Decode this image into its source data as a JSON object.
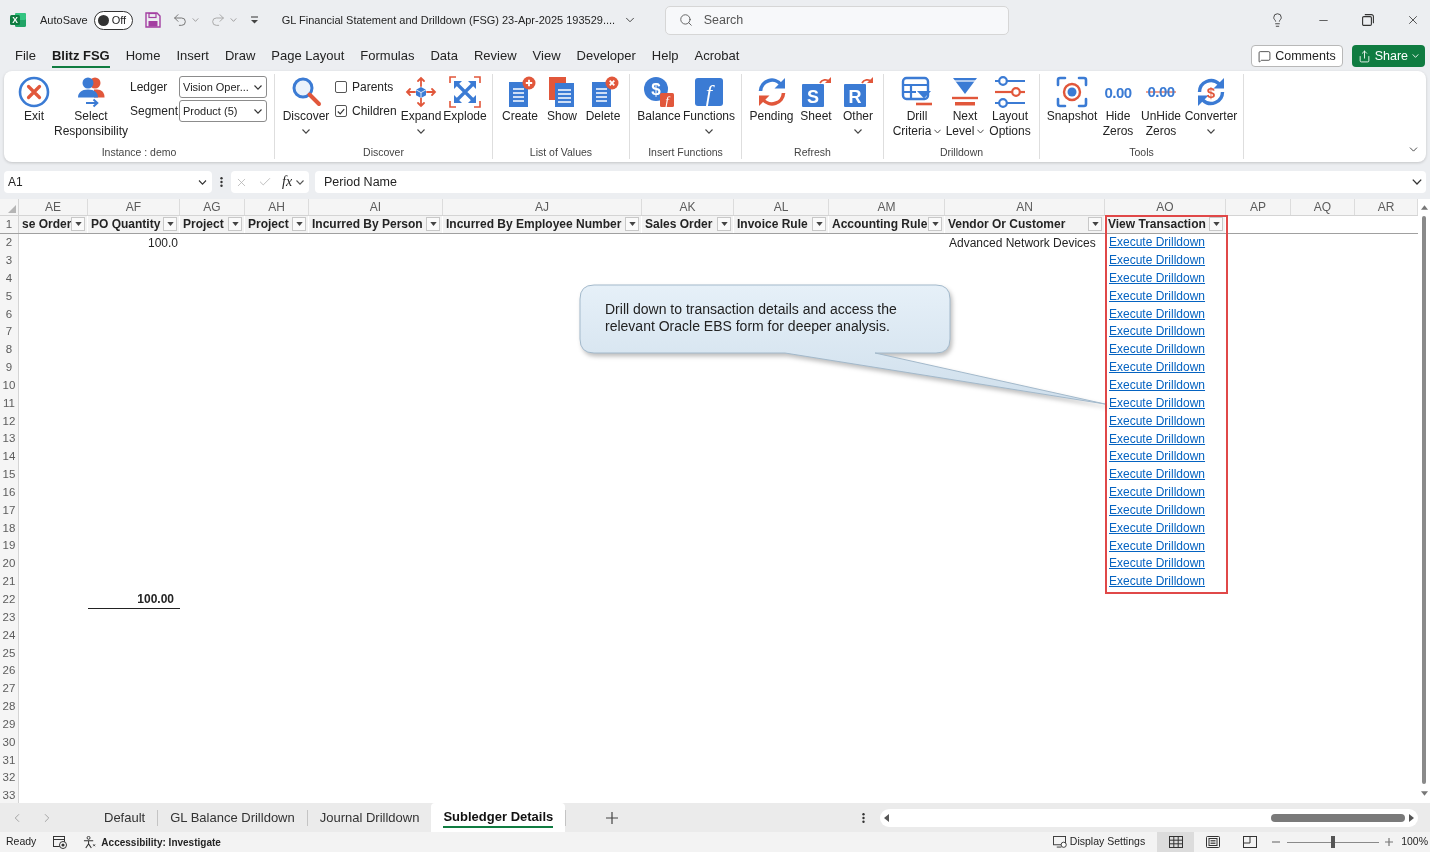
{
  "title_bar": {
    "app_logo_letter": "X",
    "autosave": {
      "label": "AutoSave",
      "toggle_text": "Off",
      "on": false
    },
    "document_title": "GL Financial Statement and Drilldown (FSG) 23-Apr-2025 193529....",
    "search": {
      "placeholder": "Search"
    }
  },
  "menu_tabs": [
    {
      "label": "File",
      "selected": false
    },
    {
      "label": "Blitz FSG",
      "selected": true
    },
    {
      "label": "Home",
      "selected": false
    },
    {
      "label": "Insert",
      "selected": false
    },
    {
      "label": "Draw",
      "selected": false
    },
    {
      "label": "Page Layout",
      "selected": false
    },
    {
      "label": "Formulas",
      "selected": false
    },
    {
      "label": "Data",
      "selected": false
    },
    {
      "label": "Review",
      "selected": false
    },
    {
      "label": "View",
      "selected": false
    },
    {
      "label": "Developer",
      "selected": false
    },
    {
      "label": "Help",
      "selected": false
    },
    {
      "label": "Acrobat",
      "selected": false
    }
  ],
  "header_buttons": [
    {
      "label": "Comments",
      "kind": "outline",
      "has_menu": false
    },
    {
      "label": "Share",
      "kind": "primary",
      "has_menu": true
    }
  ],
  "ribbon": {
    "groups": [
      {
        "label": "Instance : demo",
        "items": [
          {
            "kind": "large",
            "lines": [
              "Exit"
            ],
            "has_menu": false
          },
          {
            "kind": "large",
            "lines": [
              "Select",
              "Responsibility"
            ],
            "has_menu": false
          },
          {
            "kind": "fields",
            "fields": [
              {
                "label": "Ledger",
                "value": "Vision Oper..."
              },
              {
                "label": "Segment",
                "value": "Product (5)"
              }
            ]
          }
        ]
      },
      {
        "label": "Discover",
        "items": [
          {
            "kind": "large",
            "lines": [
              "Discover"
            ],
            "has_menu": true
          },
          {
            "kind": "checks",
            "options": [
              {
                "label": "Parents",
                "checked": false
              },
              {
                "label": "Children",
                "checked": true
              }
            ]
          },
          {
            "kind": "large",
            "lines": [
              "Expand"
            ],
            "has_menu": true
          },
          {
            "kind": "large",
            "lines": [
              "Explode"
            ],
            "has_menu": false
          }
        ]
      },
      {
        "label": "List of Values",
        "items": [
          {
            "kind": "large",
            "lines": [
              "Create"
            ],
            "has_menu": false
          },
          {
            "kind": "large",
            "lines": [
              "Show"
            ],
            "has_menu": false
          },
          {
            "kind": "large",
            "lines": [
              "Delete"
            ],
            "has_menu": false
          }
        ]
      },
      {
        "label": "Insert Functions",
        "items": [
          {
            "kind": "large",
            "lines": [
              "Balance"
            ],
            "has_menu": false,
            "icon_text": [
              "$",
              "f"
            ]
          },
          {
            "kind": "large",
            "lines": [
              "Functions"
            ],
            "has_menu": true,
            "icon_text": [
              "f"
            ]
          }
        ]
      },
      {
        "label": "Refresh",
        "items": [
          {
            "kind": "large",
            "lines": [
              "Pending"
            ],
            "has_menu": false
          },
          {
            "kind": "large",
            "lines": [
              "Sheet"
            ],
            "has_menu": false,
            "icon_text": [
              "S"
            ]
          },
          {
            "kind": "large",
            "lines": [
              "Other"
            ],
            "has_menu": true,
            "icon_text": [
              "R"
            ]
          }
        ]
      },
      {
        "label": "Drilldown",
        "items": [
          {
            "kind": "large",
            "lines": [
              "Drill",
              "Criteria"
            ],
            "has_menu": true
          },
          {
            "kind": "large",
            "lines": [
              "Next",
              "Level"
            ],
            "has_menu": true
          },
          {
            "kind": "large",
            "lines": [
              "Layout",
              "Options"
            ],
            "has_menu": false
          }
        ]
      },
      {
        "label": "Tools",
        "items": [
          {
            "kind": "large",
            "lines": [
              "Snapshot"
            ],
            "has_menu": false
          },
          {
            "kind": "large",
            "lines": [
              "Hide",
              "Zeros"
            ],
            "has_menu": false,
            "icon_text": [
              "0.00"
            ]
          },
          {
            "kind": "large",
            "lines": [
              "UnHide",
              "Zeros"
            ],
            "has_menu": false,
            "icon_text": [
              "0.00"
            ]
          },
          {
            "kind": "large",
            "lines": [
              "Converter"
            ],
            "has_menu": true,
            "icon_text": [
              "$"
            ]
          }
        ]
      }
    ]
  },
  "formula_bar": {
    "name_box": "A1",
    "function_label": "fx",
    "formula": "Period Name"
  },
  "sheet": {
    "column_letters": [
      "AE",
      "AF",
      "AG",
      "AH",
      "AI",
      "AJ",
      "AK",
      "AL",
      "AM",
      "AN",
      "AO",
      "AP",
      "AQ",
      "AR"
    ],
    "row_numbers": [
      "1",
      "2",
      "3",
      "4",
      "5",
      "6",
      "7",
      "8",
      "9",
      "10",
      "11",
      "12",
      "13",
      "14",
      "15",
      "16",
      "17",
      "18",
      "19",
      "20",
      "21",
      "22",
      "23",
      "24",
      "25",
      "26",
      "27",
      "28",
      "29",
      "30",
      "31",
      "32",
      "33"
    ],
    "header_cells": [
      {
        "text": "se Order",
        "filter": true
      },
      {
        "text": "PO Quantity",
        "filter": true
      },
      {
        "text": "Project",
        "filter": true
      },
      {
        "text": "Project",
        "filter": true
      },
      {
        "text": "Incurred By Person",
        "filter": true
      },
      {
        "text": "Incurred By Employee Number",
        "filter": true
      },
      {
        "text": "Sales Order",
        "filter": true
      },
      {
        "text": "Invoice Rule",
        "filter": true
      },
      {
        "text": "Accounting Rule",
        "filter": true
      },
      {
        "text": "Vendor Or Customer",
        "filter": true
      },
      {
        "text": "View Transaction",
        "filter": true
      }
    ],
    "rows": [
      {
        "kind": "data",
        "po_quantity": "100.0",
        "vendor_or_customer": "Advanced Network Devices",
        "view_transaction": "Execute Drilldown"
      },
      {
        "kind": "data",
        "view_transaction": "Execute Drilldown"
      },
      {
        "kind": "data",
        "view_transaction": "Execute Drilldown"
      },
      {
        "kind": "data",
        "view_transaction": "Execute Drilldown"
      },
      {
        "kind": "data",
        "view_transaction": "Execute Drilldown"
      },
      {
        "kind": "data",
        "view_transaction": "Execute Drilldown"
      },
      {
        "kind": "data",
        "view_transaction": "Execute Drilldown"
      },
      {
        "kind": "data",
        "view_transaction": "Execute Drilldown"
      },
      {
        "kind": "data",
        "view_transaction": "Execute Drilldown"
      },
      {
        "kind": "data",
        "view_transaction": "Execute Drilldown"
      },
      {
        "kind": "data",
        "view_transaction": "Execute Drilldown"
      },
      {
        "kind": "data",
        "view_transaction": "Execute Drilldown"
      },
      {
        "kind": "data",
        "view_transaction": "Execute Drilldown"
      },
      {
        "kind": "data",
        "view_transaction": "Execute Drilldown"
      },
      {
        "kind": "data",
        "view_transaction": "Execute Drilldown"
      },
      {
        "kind": "data",
        "view_transaction": "Execute Drilldown"
      },
      {
        "kind": "data",
        "view_transaction": "Execute Drilldown"
      },
      {
        "kind": "data",
        "view_transaction": "Execute Drilldown"
      },
      {
        "kind": "data",
        "view_transaction": "Execute Drilldown"
      },
      {
        "kind": "data",
        "view_transaction": "Execute Drilldown"
      },
      {
        "kind": "total",
        "po_quantity": "100.00"
      }
    ],
    "callout": {
      "text": "Drill down to transaction details and access the relevant Oracle EBS form for deeper analysis."
    }
  },
  "sheet_tabs": [
    {
      "label": "Default",
      "selected": false
    },
    {
      "label": "GL Balance Drilldown",
      "selected": false
    },
    {
      "label": "Journal Drilldown",
      "selected": false
    },
    {
      "label": "Subledger Details",
      "selected": true
    }
  ],
  "status_bar": {
    "ready": "Ready",
    "accessibility": "Accessibility: Investigate",
    "display_settings": "Display Settings",
    "view_buttons": [
      {
        "selected": true
      },
      {
        "selected": false
      },
      {
        "selected": false
      }
    ],
    "zoom": {
      "level": 0.5,
      "reading": "100%"
    }
  }
}
